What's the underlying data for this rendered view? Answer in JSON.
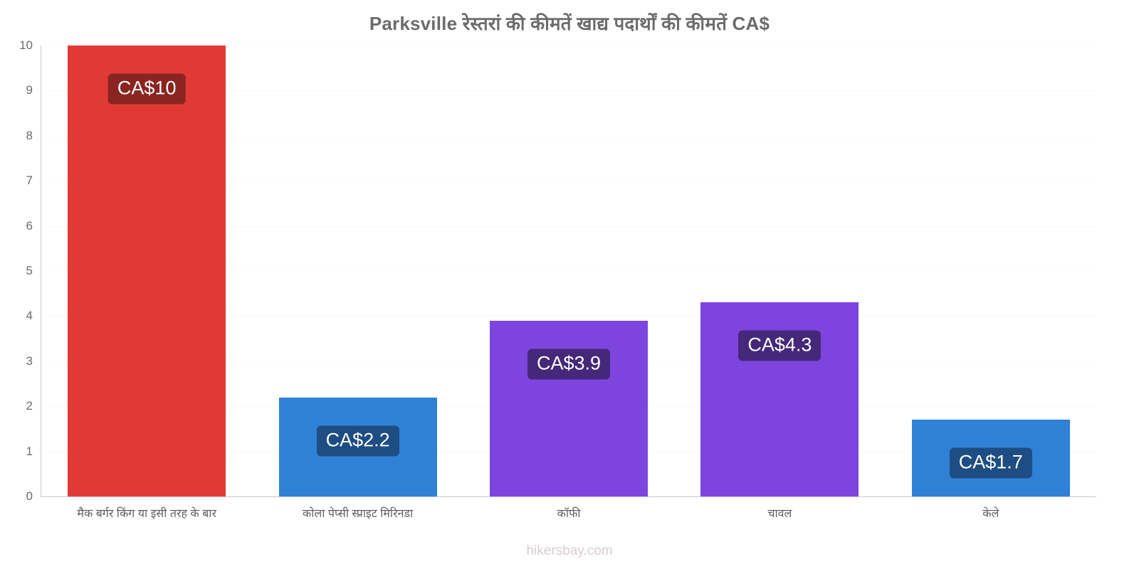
{
  "chart_data": {
    "type": "bar",
    "title": "Parksville रेस्तरां की कीमतें खाद्य पदार्थों की कीमतें CA$",
    "xlabel": "",
    "ylabel": "",
    "ylim": [
      0,
      10
    ],
    "y_ticks": [
      "0",
      "1",
      "2",
      "3",
      "4",
      "5",
      "6",
      "7",
      "8",
      "9",
      "10"
    ],
    "grid": true,
    "legend": "none",
    "currency": "CA$",
    "categories": [
      "मैक बर्गर किंग या इसी तरह के बार",
      "कोला पेप्सी स्प्राइट मिरिनडा",
      "कॉफी",
      "चावल",
      "केले"
    ],
    "values": [
      10,
      2.2,
      3.9,
      4.3,
      1.7
    ],
    "data_labels": [
      "CA$10",
      "CA$2.2",
      "CA$3.9",
      "CA$4.3",
      "CA$1.7"
    ],
    "bar_colors": [
      "#e13a36",
      "#2f81d6",
      "#7e45de",
      "#7e45de",
      "#2f81d6"
    ],
    "label_bg_colors": [
      "#8a2420",
      "#1d4d82",
      "#452879",
      "#452879",
      "#1d4d82"
    ],
    "title_color": "#6b6b6b",
    "axis_color": "#c8c8cf",
    "tick_text_color": "#6b6b6b"
  },
  "footer": {
    "watermark": "hikersbay.com"
  }
}
